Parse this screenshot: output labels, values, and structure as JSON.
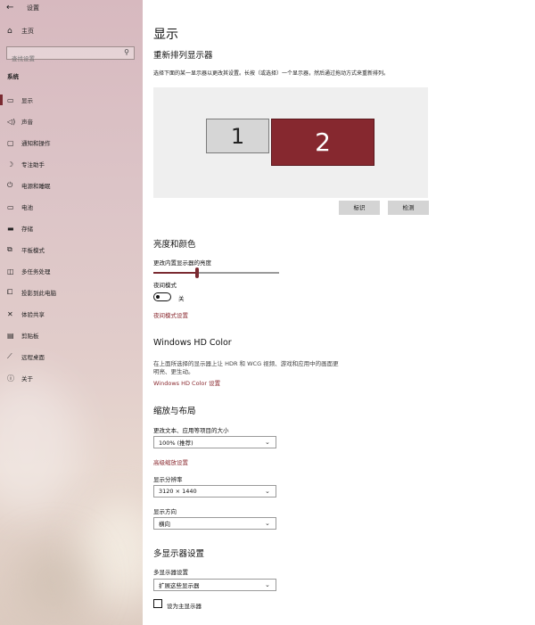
{
  "window": {
    "app_title": "设置"
  },
  "sidebar": {
    "home_label": "主页",
    "search_placeholder": "查找设置",
    "section_label": "系统",
    "items": [
      {
        "label": "显示",
        "icon": "monitor-icon"
      },
      {
        "label": "声音",
        "icon": "speaker-icon"
      },
      {
        "label": "通知和操作",
        "icon": "message-icon"
      },
      {
        "label": "专注助手",
        "icon": "moon-icon"
      },
      {
        "label": "电源和睡眠",
        "icon": "power-icon"
      },
      {
        "label": "电池",
        "icon": "battery-icon"
      },
      {
        "label": "存储",
        "icon": "storage-icon"
      },
      {
        "label": "平板模式",
        "icon": "tablet-icon"
      },
      {
        "label": "多任务处理",
        "icon": "multitask-icon"
      },
      {
        "label": "投影到此电脑",
        "icon": "project-icon"
      },
      {
        "label": "体验共享",
        "icon": "share-icon"
      },
      {
        "label": "剪贴板",
        "icon": "clipboard-icon"
      },
      {
        "label": "远程桌面",
        "icon": "remote-icon"
      },
      {
        "label": "关于",
        "icon": "info-icon"
      }
    ]
  },
  "main": {
    "page_title": "显示",
    "rearrange_title": "重新排列显示器",
    "rearrange_desc": "选择下面的某一显示器以更改其设置。长按（或选择）一个显示器，然后通过拖动方式来重新排列。",
    "monitor_1": "1",
    "monitor_2": "2",
    "identify_label": "标识",
    "detect_label": "检测",
    "brightness_title": "亮度和颜色",
    "brightness_label": "更改内置显示器的亮度",
    "brightness_value": 0.35,
    "night_light_label": "夜间模式",
    "night_light_state": "关",
    "night_light_link": "夜间模式设置",
    "hdr_title": "Windows HD Color",
    "hdr_desc_line1": "在上面所选择的显示器上让 HDR 和 WCG 视频、游戏和应用中的画面更",
    "hdr_desc_line2": "明亮、更生动。",
    "hdr_link": "Windows HD Color 设置",
    "scale_title": "缩放与布局",
    "scale_label": "更改文本、应用等项目的大小",
    "scale_value": "100% (推荐)",
    "advanced_scale_link": "高级缩放设置",
    "resolution_label": "显示分辨率",
    "resolution_value": "3120 × 1440",
    "orientation_label": "显示方向",
    "orientation_value": "横向",
    "multi_title": "多显示器设置",
    "multi_label": "多显示器设置",
    "multi_value": "扩展这些显示器",
    "primary_checkbox_label": "设为主显示器"
  },
  "colors": {
    "accent": "#7a2a31",
    "monitor_selected": "#86282f",
    "monitor_default": "#d6d6d6"
  }
}
